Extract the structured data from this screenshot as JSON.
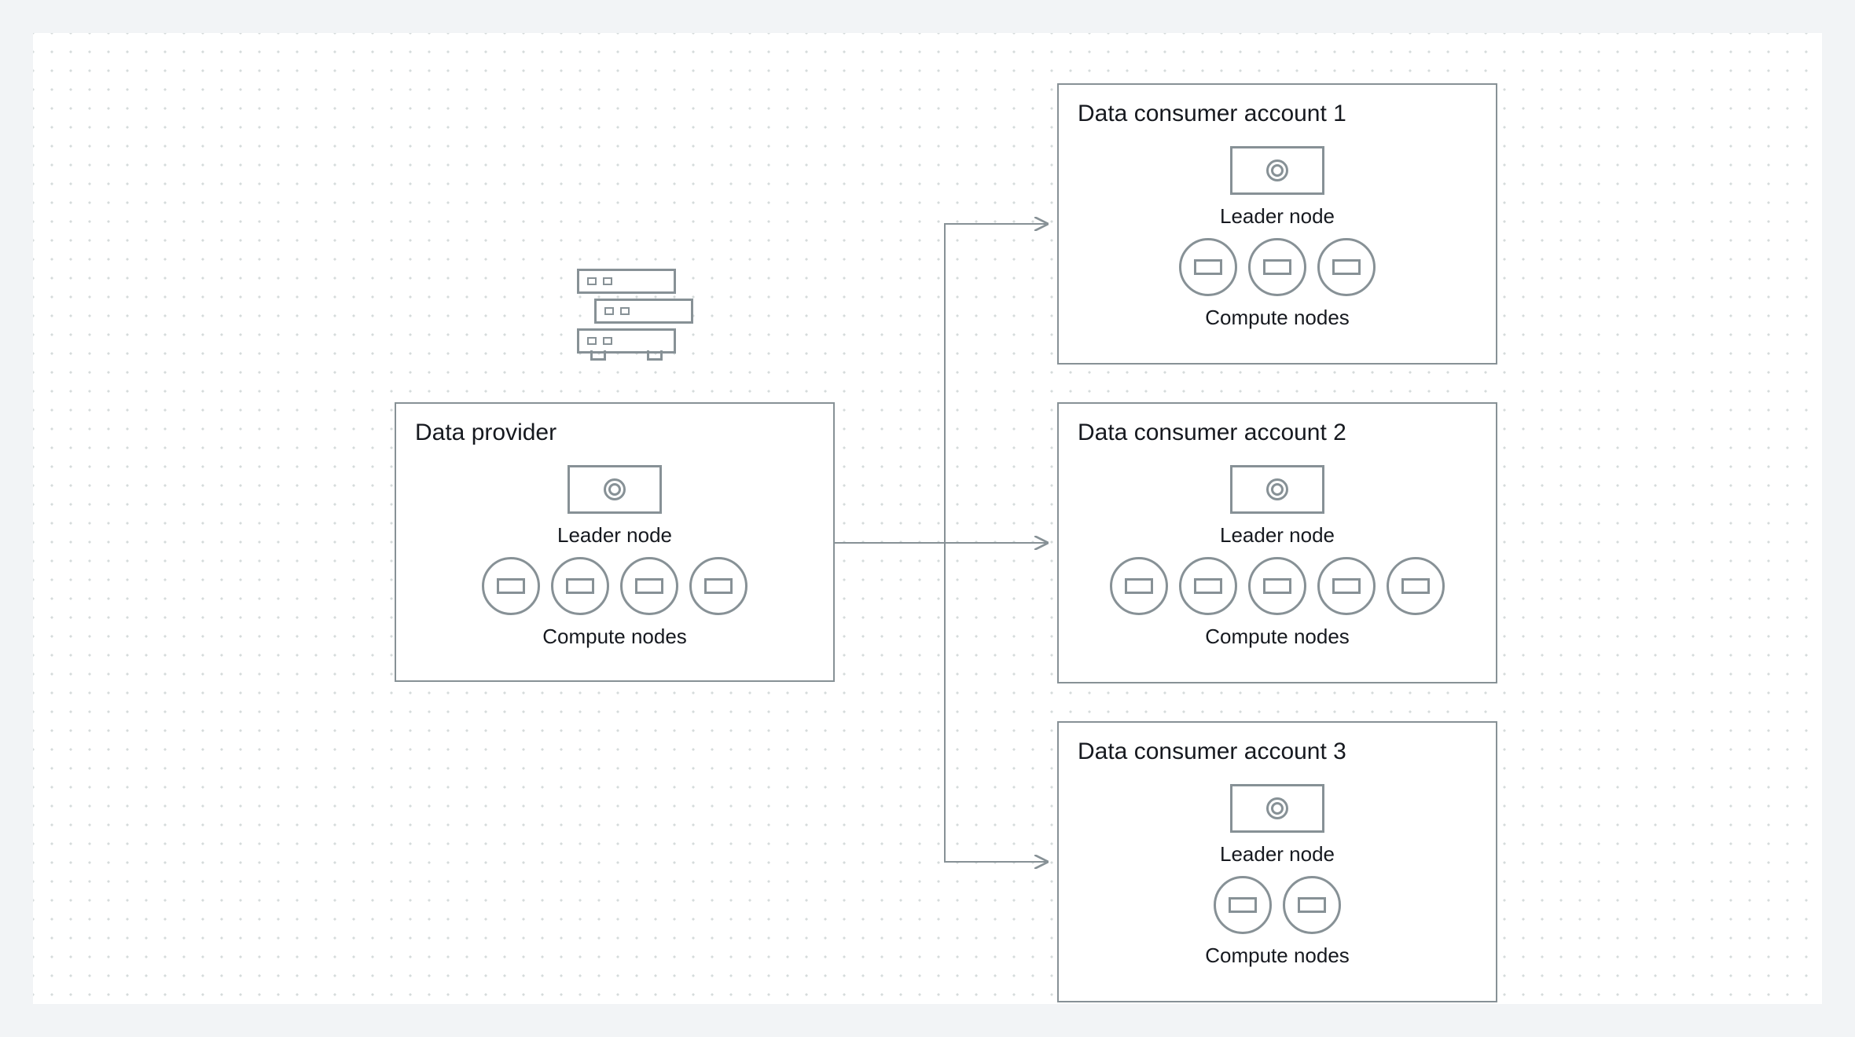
{
  "provider": {
    "title": "Data provider",
    "leader_label": "Leader node",
    "compute_label": "Compute nodes",
    "compute_count": 4
  },
  "consumers": [
    {
      "title": "Data consumer account 1",
      "leader_label": "Leader node",
      "compute_label": "Compute nodes",
      "compute_count": 3
    },
    {
      "title": "Data consumer account 2",
      "leader_label": "Leader node",
      "compute_label": "Compute nodes",
      "compute_count": 5
    },
    {
      "title": "Data consumer account 3",
      "leader_label": "Leader node",
      "compute_label": "Compute nodes",
      "compute_count": 2
    }
  ],
  "colors": {
    "outline": "#879196",
    "page_bg": "#f2f4f6",
    "canvas_bg": "#ffffff",
    "text": "#16191f"
  }
}
